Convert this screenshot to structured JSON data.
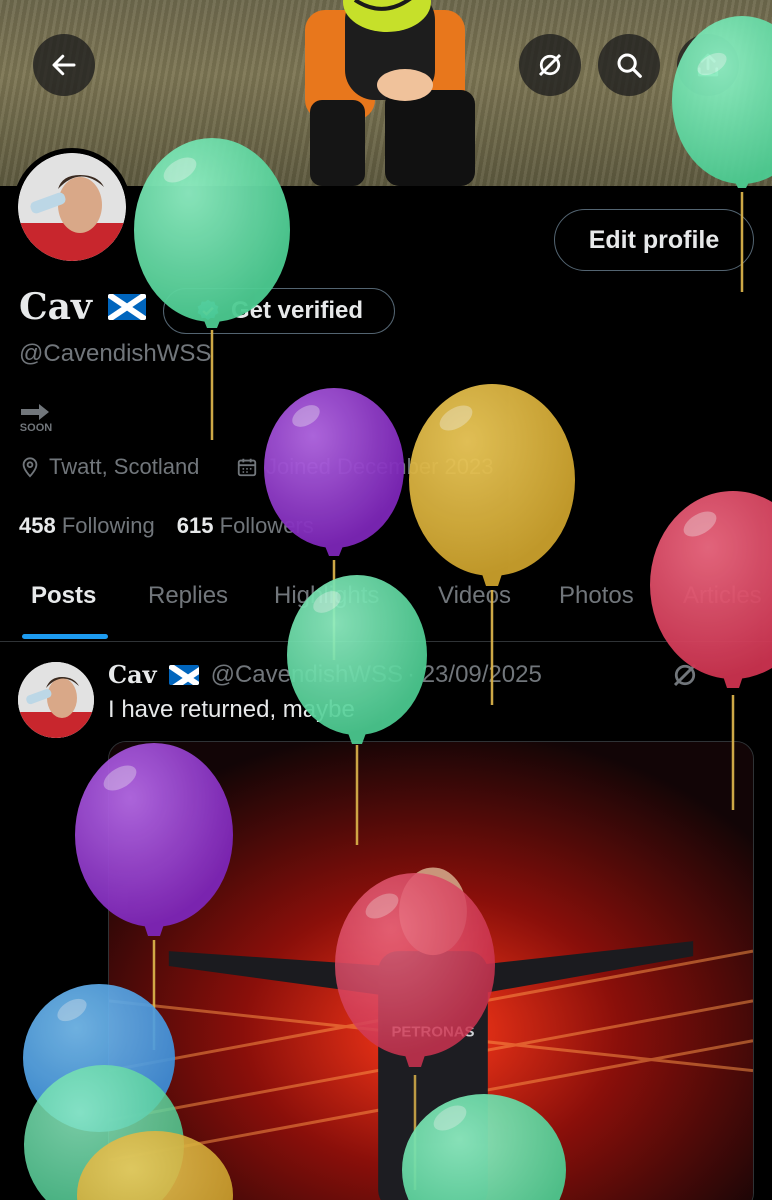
{
  "header": {
    "back_icon": "arrow-left-icon",
    "grok_icon": "grok-icon",
    "search_icon": "search-icon",
    "share_icon": "share-icon"
  },
  "profile": {
    "display_name": "Cav",
    "flag_icon": "scotland-flag-icon",
    "handle": "@CavendishWSS",
    "edit_label": "Edit profile",
    "verify_label": "Get verified",
    "soon_label": "SOON",
    "location": "Twatt, Scotland",
    "joined": "Joined December 2023",
    "following_count": "458",
    "following_label": "Following",
    "followers_count": "615",
    "followers_label": "Followers"
  },
  "tabs": [
    {
      "label": "Posts",
      "active": true
    },
    {
      "label": "Replies"
    },
    {
      "label": "Highlights"
    },
    {
      "label": "Videos"
    },
    {
      "label": "Photos"
    },
    {
      "label": "Articles"
    }
  ],
  "post": {
    "name": "Cav",
    "handle": "@CavendishWSS",
    "date": "· 23/09/2025",
    "text": "I have returned, maybe",
    "image_caption": "PETRONAS"
  },
  "colors": {
    "accent": "#1d9bf0",
    "muted": "#71767b",
    "balloon_green": "#5fd6a0",
    "balloon_purple": "#8e37c9",
    "balloon_yellow": "#d8b03a",
    "balloon_red": "#d9435e",
    "balloon_blue": "#4aa0e8"
  }
}
